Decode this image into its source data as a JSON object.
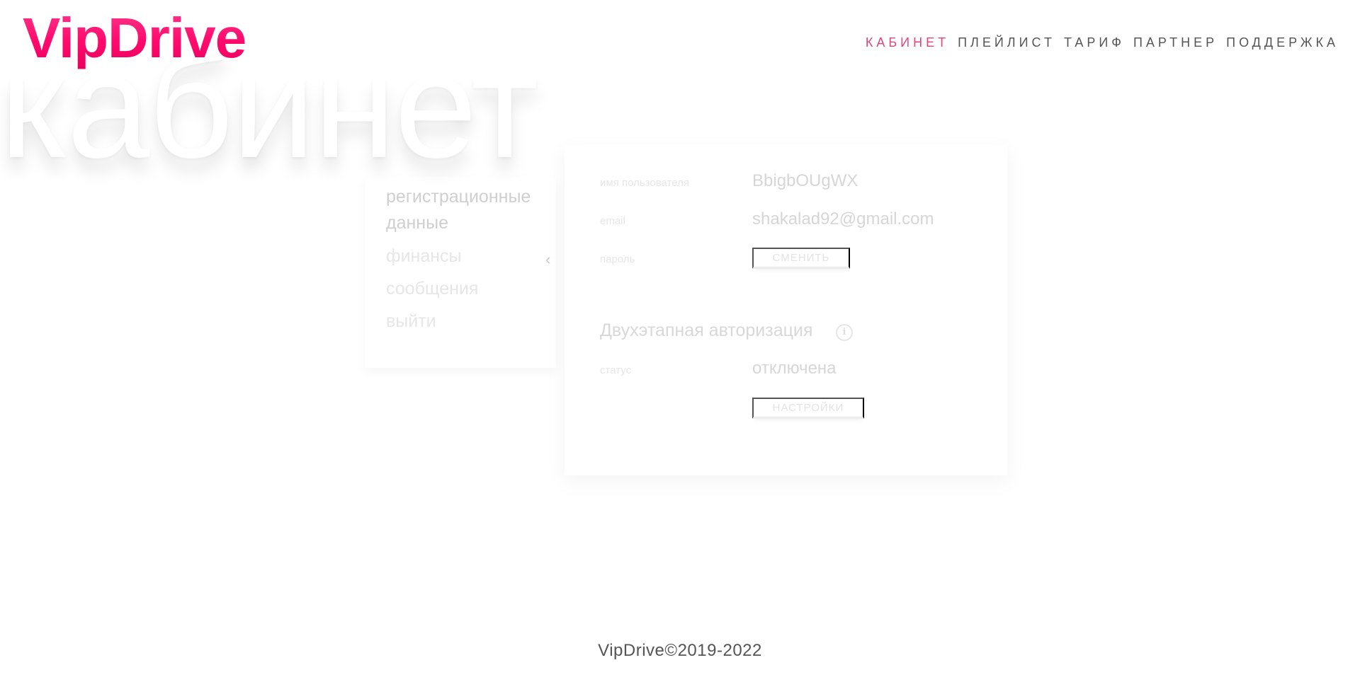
{
  "brand": {
    "logo": "VipDrive"
  },
  "nav": {
    "items": [
      {
        "label": "КАБИНЕТ",
        "active": true
      },
      {
        "label": "ПЛЕЙЛИСТ",
        "active": false
      },
      {
        "label": "ТАРИФ",
        "active": false
      },
      {
        "label": "ПАРТНЕР",
        "active": false
      },
      {
        "label": "ПОДДЕРЖКА",
        "active": false
      }
    ]
  },
  "page_heading": "кабинет",
  "side_menu": {
    "items": [
      {
        "label": "регистрационные данные"
      },
      {
        "label": "финансы"
      },
      {
        "label": "сообщения"
      },
      {
        "label": "выйти"
      }
    ],
    "expand_icon": "chevron-left-icon"
  },
  "account": {
    "username_label": "имя пользователя",
    "username_value": "BbigbOUgWX",
    "email_label": "email",
    "email_value": "shakalad92@gmail.com",
    "password_label": "пароль",
    "password_button": "СМЕНИТЬ"
  },
  "two_factor": {
    "title": "Двухэтапная авторизация",
    "info_icon": "info-icon",
    "status_label": "статус",
    "status_value": "отключена",
    "settings_button": "НАСТРОЙКИ"
  },
  "footer": {
    "text": "VipDrive©2019-2022"
  },
  "colors": {
    "brand_pink": "#ff0a6c",
    "nav_active": "#e0467e",
    "nav_text": "#555555"
  }
}
